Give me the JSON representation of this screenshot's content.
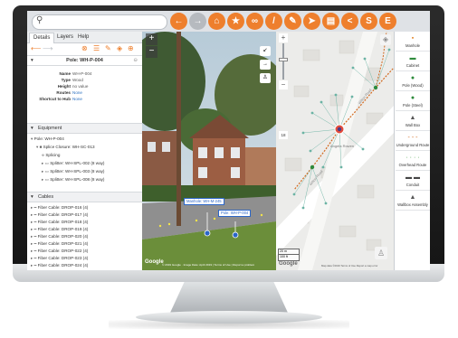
{
  "toolbar": {
    "search_placeholder": "",
    "tools": [
      {
        "icon": "back-arrow-icon",
        "glyph": "←",
        "style": "orange"
      },
      {
        "icon": "forward-arrow-icon",
        "glyph": "→",
        "style": "grey"
      },
      {
        "icon": "home-icon",
        "glyph": "⌂",
        "style": "orange"
      },
      {
        "icon": "star-icon",
        "glyph": "★",
        "style": "orange"
      },
      {
        "icon": "link-icon",
        "glyph": "∞",
        "style": "orange"
      },
      {
        "icon": "measure-icon",
        "glyph": "/",
        "style": "orange"
      },
      {
        "icon": "pencil-icon",
        "glyph": "✎",
        "style": "orange"
      },
      {
        "icon": "navigate-icon",
        "glyph": "➤",
        "style": "orange"
      },
      {
        "icon": "print-icon",
        "glyph": "▤",
        "style": "orange"
      },
      {
        "icon": "share-icon",
        "glyph": "<",
        "style": "orange"
      },
      {
        "icon": "s-icon",
        "glyph": "S",
        "style": "orange"
      },
      {
        "icon": "e-icon",
        "glyph": "E",
        "style": "orange"
      }
    ]
  },
  "panel": {
    "tabs": [
      "Details",
      "Layers",
      "Help"
    ],
    "pole_title": "Pole: WH-P-004",
    "properties": [
      {
        "key": "Name",
        "value": "WH-P-004",
        "link": false
      },
      {
        "key": "Type",
        "value": "Wood",
        "link": false
      },
      {
        "key": "Height",
        "value": "no value",
        "link": false
      },
      {
        "key": "Routes",
        "value": "None",
        "link": true
      },
      {
        "key": "Shortcut to Hub",
        "value": "None",
        "link": true
      }
    ],
    "equipment_header": "Equipment",
    "equipment": [
      {
        "level": 0,
        "text": "Pole: WH-P-004"
      },
      {
        "level": 1,
        "text": "Splice Closure: WH-SC-013"
      },
      {
        "level": 2,
        "text": "Splicing"
      },
      {
        "level": 2,
        "text": "Splitter: WH-SPL-002 (8 way)"
      },
      {
        "level": 2,
        "text": "Splitter: WH-SPL-003 (8 way)"
      },
      {
        "level": 2,
        "text": "Splitter: WH-SPL-008 (8 way)"
      }
    ],
    "cables_header": "Cables",
    "cables": [
      "Fiber Cable: DROP-016 (4)",
      "Fiber Cable: DROP-017 (4)",
      "Fiber Cable: DROP-018 (4)",
      "Fiber Cable: DROP-019 (4)",
      "Fiber Cable: DROP-020 (4)",
      "Fiber Cable: DROP-021 (4)",
      "Fiber Cable: DROP-022 (4)",
      "Fiber Cable: DROP-023 (4)",
      "Fiber Cable: DROP-024 (4)"
    ]
  },
  "streetview": {
    "label_manhole": "Manhole: WH-M-245",
    "label_pole": "Pole: WH-P-004",
    "footer": "© 2019 Google · Image Date: April 2019 | Terms of Use | Report a problem",
    "google": "Google"
  },
  "map": {
    "labels": [
      "Angela Rowen",
      "Wilton Road",
      "Wilton Road"
    ],
    "scale_m": "20 m",
    "scale_ft": "100 ft",
    "footer": "Map data ©2019  Terms of Use  Report a map error",
    "google": "Google"
  },
  "palette": [
    {
      "label": "Manhole",
      "icon": "manhole-icon",
      "glyph": "▪",
      "color": "#e58a2f"
    },
    {
      "label": "Cabinet",
      "icon": "cabinet-icon",
      "glyph": "▬",
      "color": "#2e8b3c"
    },
    {
      "label": "Pole (Wood)",
      "icon": "pole-wood-icon",
      "glyph": "●",
      "color": "#2e8b3c"
    },
    {
      "label": "Pole (Steel)",
      "icon": "pole-steel-icon",
      "glyph": "●",
      "color": "#2e8b3c"
    },
    {
      "label": "Wall Box",
      "icon": "wall-box-icon",
      "glyph": "▲",
      "color": "#555555"
    },
    {
      "label": "Underground Route",
      "icon": "underground-route-icon",
      "glyph": "- - -",
      "color": "#d2691e"
    },
    {
      "label": "Overhead Route",
      "icon": "overhead-route-icon",
      "glyph": "· · · ·",
      "color": "#3a9a3a"
    },
    {
      "label": "Conduit",
      "icon": "conduit-icon",
      "glyph": "▬ ▬",
      "color": "#444444"
    },
    {
      "label": "Wallbox Assembly",
      "icon": "wallbox-assembly-icon",
      "glyph": "▲",
      "color": "#555555"
    }
  ]
}
